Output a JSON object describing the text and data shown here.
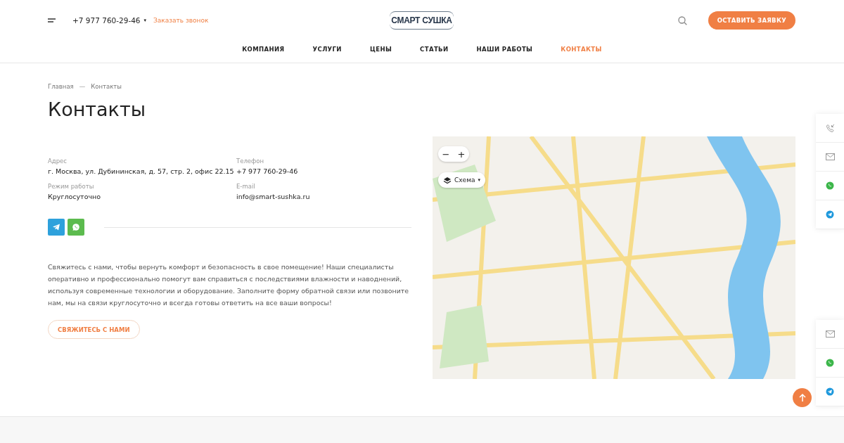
{
  "header": {
    "phone": "+7 977 760-29-46",
    "phone_caret": "▾",
    "callback_link": "Заказать звонок",
    "logo": "СМАРТ СУШКА",
    "cta_button": "ОСТАВИТЬ ЗАЯВКУ"
  },
  "nav": [
    {
      "label": "КОМПАНИЯ",
      "selected": false
    },
    {
      "label": "УСЛУГИ",
      "selected": false
    },
    {
      "label": "ЦЕНЫ",
      "selected": false
    },
    {
      "label": "СТАТЬИ",
      "selected": false
    },
    {
      "label": "НАШИ РАБОТЫ",
      "selected": false
    },
    {
      "label": "КОНТАКТЫ",
      "selected": true
    }
  ],
  "breadcrumbs": [
    "Главная",
    "Контакты"
  ],
  "breadcrumb_separator": "—",
  "title": "Контакты",
  "contacts": [
    {
      "label": "Адрес",
      "value": "г. Москва, ул. Дубининская, д. 57, стр. 2, офис 22.15"
    },
    {
      "label": "Телефон",
      "value": "+7 977 760-29-46"
    },
    {
      "label": "Режим работы",
      "value": "Круглосуточно"
    },
    {
      "label": "E-mail",
      "value": "info@smart-sushka.ru"
    }
  ],
  "socials": [
    {
      "kind": "telegram",
      "color": "#2ea1dc"
    },
    {
      "kind": "whatsapp",
      "color": "#5cbb4e"
    }
  ],
  "description": "Свяжитесь с нами, чтобы вернуть комфорт и безопасность в свое помещение! Наши специалисты оперативно и профессионально помогут вам справиться с последствиями влажности и наводнений, используя современные технологии и оборудование. Заполните форму обратной связи или позвоните нам, мы на связи круглосуточно и всегда готовы ответить на все ваши вопросы!",
  "contact_button": "СВЯЖИТЕСЬ С НАМИ",
  "map": {
    "zoom_out": "−",
    "zoom_in": "+",
    "layer_button": "Схема",
    "layer_caret": "▾"
  },
  "side_panel_top": [
    {
      "kind": "callback"
    },
    {
      "kind": "mail"
    },
    {
      "kind": "whatsapp"
    },
    {
      "kind": "telegram"
    }
  ],
  "side_panel_bottom": [
    {
      "kind": "mail"
    },
    {
      "kind": "whatsapp"
    },
    {
      "kind": "telegram"
    }
  ]
}
